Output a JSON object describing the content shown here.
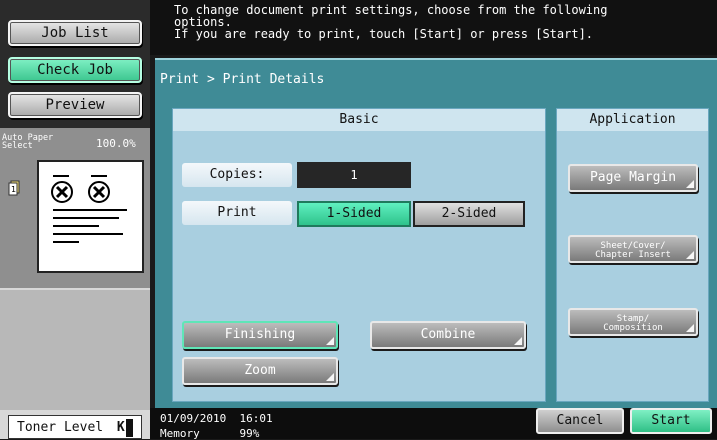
{
  "sidebar": {
    "job_list": "Job List",
    "check_job": "Check Job",
    "preview": "Preview",
    "paper_label": "Auto Paper\nSelect",
    "zoom": "100.0%",
    "toner_label": "Toner Level",
    "toner_letter": "K"
  },
  "message": {
    "line1": "To change document print settings, choose from the following",
    "line2": "options.",
    "line3": "If you are ready to print, touch [Start] or press [Start]."
  },
  "breadcrumb": "Print > Print Details",
  "basic": {
    "header": "Basic",
    "copies_label": "Copies:",
    "copies_value": "1",
    "print_label": "Print",
    "one_sided": "1-Sided",
    "two_sided": "2-Sided",
    "finishing": "Finishing",
    "combine": "Combine",
    "zoom": "Zoom"
  },
  "application": {
    "header": "Application",
    "page_margin": "Page Margin",
    "sheet_cover_1": "Sheet/Cover/",
    "sheet_cover_2": "Chapter Insert",
    "stamp_1": "Stamp/",
    "stamp_2": "Composition"
  },
  "status": {
    "datetime": "01/09/2010  16:01",
    "memory": "Memory      99%"
  },
  "footer": {
    "cancel": "Cancel",
    "start": "Start"
  },
  "colors": {
    "accent_green": "#3cc68f",
    "panel_teal": "#3f8b96"
  }
}
